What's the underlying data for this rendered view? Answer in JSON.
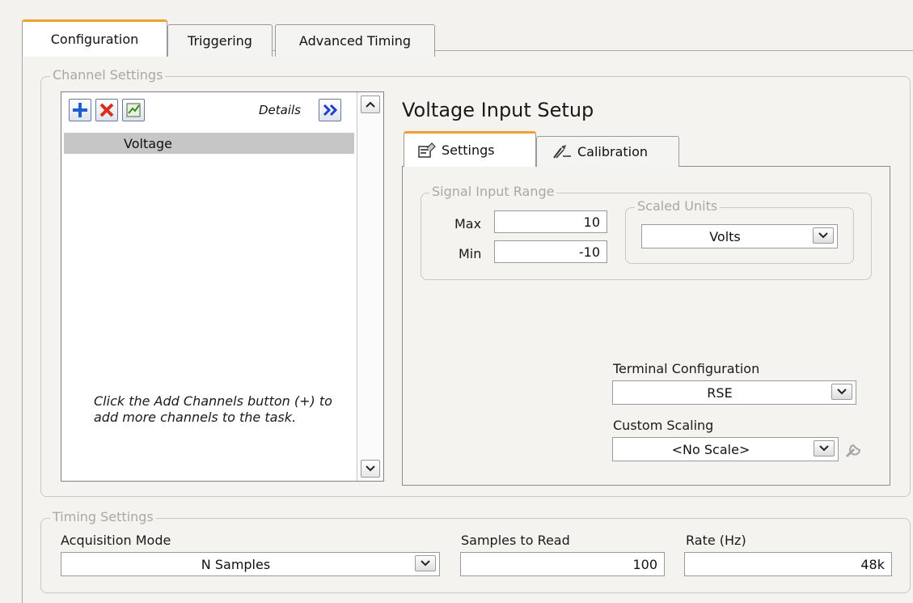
{
  "main_tabs": [
    {
      "label": "Configuration"
    },
    {
      "label": "Triggering"
    },
    {
      "label": "Advanced Timing"
    }
  ],
  "channel_settings": {
    "legend": "Channel Settings",
    "details_label": "Details",
    "channels": [
      "Voltage"
    ],
    "hint": "Click the Add Channels button (+) to add more channels to the task."
  },
  "voltage_setup": {
    "title": "Voltage Input Setup",
    "tabs": [
      {
        "label": "Settings"
      },
      {
        "label": "Calibration"
      }
    ],
    "signal_input_range": {
      "legend": "Signal Input Range",
      "max_label": "Max",
      "max_value": "10",
      "min_label": "Min",
      "min_value": "-10"
    },
    "scaled_units": {
      "legend": "Scaled Units",
      "value": "Volts"
    },
    "terminal_configuration": {
      "label": "Terminal Configuration",
      "value": "RSE"
    },
    "custom_scaling": {
      "label": "Custom Scaling",
      "value": "<No Scale>"
    }
  },
  "timing_settings": {
    "legend": "Timing Settings",
    "acquisition_mode": {
      "label": "Acquisition Mode",
      "value": "N Samples"
    },
    "samples_to_read": {
      "label": "Samples to Read",
      "value": "100"
    },
    "rate": {
      "label": "Rate (Hz)",
      "value": "48k"
    }
  },
  "colors": {
    "active_tab_accent": "#f0a030",
    "add_icon": "#1f5fd0",
    "remove_icon": "#d83020",
    "details_arrow": "#1f3fd0"
  }
}
